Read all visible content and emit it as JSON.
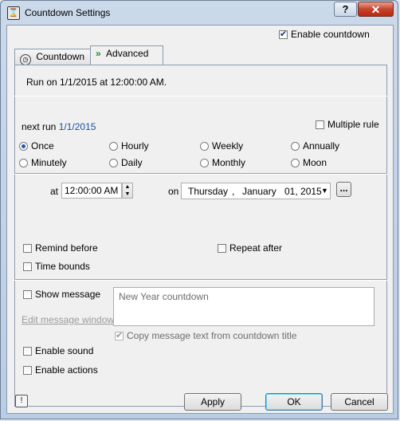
{
  "window": {
    "title": "Countdown Settings",
    "help_label": "?",
    "close_label": "✕",
    "app_icon_glyph": "⌛"
  },
  "enable_countdown": {
    "label": "Enable countdown",
    "checked": true
  },
  "tabs": [
    {
      "label": "Countdown",
      "icon": "timer-icon",
      "active": false
    },
    {
      "label": "Advanced",
      "icon": "double-chevron-icon",
      "active": true
    }
  ],
  "summary": {
    "text": "Run on 1/1/2015 at 12:00:00 AM."
  },
  "next_run": {
    "label": "next run",
    "value": "1/1/2015"
  },
  "multiple_rule": {
    "label": "Multiple rule",
    "checked": false
  },
  "frequency": {
    "selected": "Once",
    "options": [
      "Once",
      "Hourly",
      "Weekly",
      "Annually",
      "Minutely",
      "Daily",
      "Monthly",
      "Moon"
    ]
  },
  "schedule": {
    "at_label": "at",
    "time_value": "12:00:00 AM",
    "on_label": "on",
    "date_weekday": "Thursday",
    "date_sep1": ",",
    "date_month": "January",
    "date_day_year": "01, 2015",
    "browse_label": "..."
  },
  "remind_before": {
    "label": "Remind before",
    "checked": false
  },
  "repeat_after": {
    "label": "Repeat after",
    "checked": false
  },
  "time_bounds": {
    "label": "Time bounds",
    "checked": false
  },
  "message": {
    "show_label": "Show message",
    "show_checked": false,
    "edit_window_label": "Edit message window",
    "text": "New Year countdown",
    "copy_label": "Copy message text from countdown title",
    "copy_checked": true
  },
  "enable_sound": {
    "label": "Enable sound",
    "checked": false
  },
  "enable_actions": {
    "label": "Enable actions",
    "checked": false
  },
  "buttons": {
    "apply": "Apply",
    "ok": "OK",
    "cancel": "Cancel"
  },
  "colors": {
    "link": "#1a4fa3",
    "close": "#c7432b",
    "focus": "#3c7fb1"
  }
}
